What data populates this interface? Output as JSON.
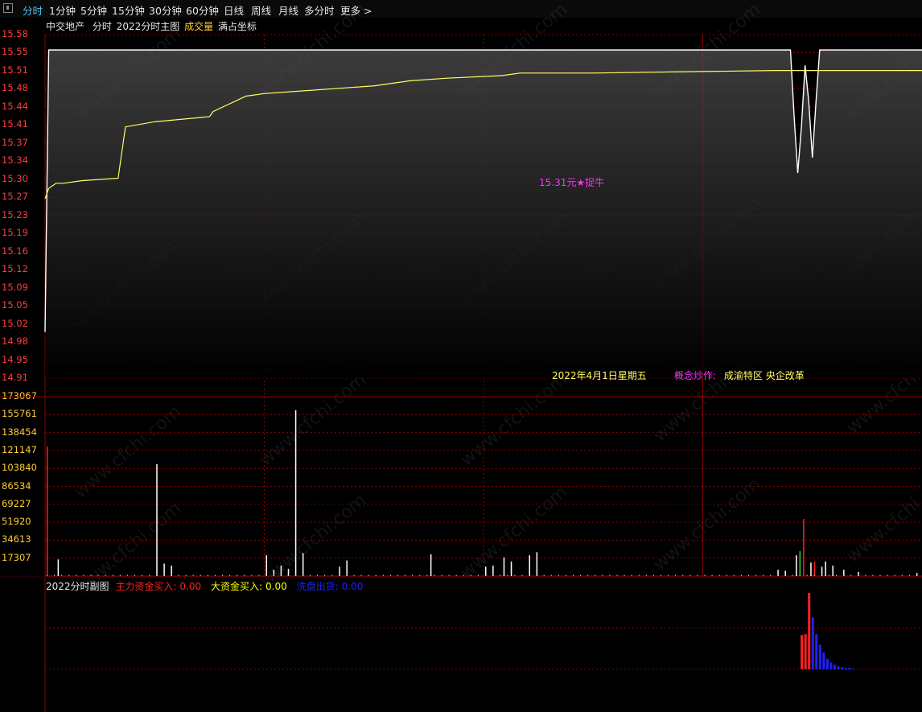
{
  "toolbar": {
    "tabs": [
      {
        "label": "分时",
        "active": true
      },
      {
        "label": "1分钟"
      },
      {
        "label": "5分钟"
      },
      {
        "label": "15分钟"
      },
      {
        "label": "30分钟"
      },
      {
        "label": "60分钟"
      },
      {
        "label": "日线"
      },
      {
        "label": "周线"
      },
      {
        "label": "月线"
      },
      {
        "label": "多分时"
      },
      {
        "label": "更多 >"
      }
    ]
  },
  "info": {
    "stock_name": "中交地产",
    "period": "分时",
    "indicator": "2022分时主图",
    "volume_label": "成交量",
    "scale_mode": "满占坐标"
  },
  "watermark": "www.cfchi.com",
  "annotations": {
    "signal": "15.31元★捉牛",
    "date": "2022年4月1日星期五",
    "concept_label": "概念炒作:",
    "concept_value": "成渝特区 央企改革"
  },
  "subchart": {
    "title": "2022分时副图",
    "main_label": "主力资金买入:",
    "main_value": "0.00",
    "big_label": "大资金买入:",
    "big_value": "0.00",
    "wash_label": "洗盘出货:",
    "wash_value": "0.00"
  },
  "colors": {
    "grid": "#8b0000",
    "price_axis": "#ff3c3c",
    "volume_axis": "#ffcc33",
    "avg_line": "#ffff66",
    "price_line": "#ffffff",
    "signal": "#ff33ff",
    "main_funds": "#ff2020",
    "big_funds": "#ffff00",
    "wash": "#2020ff"
  },
  "chart_data": [
    {
      "type": "line",
      "title": "2022分时主图",
      "y_ticks": [
        "15.58",
        "15.55",
        "15.51",
        "15.48",
        "15.44",
        "15.41",
        "15.37",
        "15.34",
        "15.30",
        "15.27",
        "15.23",
        "15.19",
        "15.16",
        "15.12",
        "15.09",
        "15.05",
        "15.02",
        "14.98",
        "14.95",
        "14.91"
      ],
      "ylim": [
        14.91,
        15.58
      ],
      "x": [
        0,
        1,
        2,
        3,
        5,
        10,
        20,
        22,
        30,
        45,
        46,
        55,
        60,
        70,
        80,
        90,
        100,
        110,
        125,
        130,
        135,
        150,
        200,
        226,
        229,
        232,
        235,
        240
      ],
      "series": [
        {
          "values": [
            15.0,
            15.55,
            15.55,
            15.55,
            15.55,
            15.55,
            15.55,
            15.55,
            15.55,
            15.55,
            15.55,
            15.55,
            15.55,
            15.55,
            15.55,
            15.55,
            15.55,
            15.55,
            15.55,
            15.55,
            15.55,
            15.55,
            15.55,
            15.55,
            15.55,
            15.55,
            15.55,
            15.55
          ]
        },
        {
          "values": [
            15.26,
            15.28,
            15.285,
            15.29,
            15.29,
            15.295,
            15.3,
            15.4,
            15.41,
            15.42,
            15.43,
            15.46,
            15.465,
            15.47,
            15.475,
            15.48,
            15.49,
            15.495,
            15.5,
            15.505,
            15.505,
            15.505,
            15.51,
            15.51,
            15.51,
            15.51,
            15.51,
            15.51
          ]
        }
      ],
      "dip": {
        "x": [
          204,
          205,
          206,
          207,
          208,
          209,
          210,
          211,
          212
        ],
        "values": [
          15.55,
          15.42,
          15.31,
          15.4,
          15.52,
          15.45,
          15.34,
          15.45,
          15.55
        ]
      },
      "grid": true
    },
    {
      "type": "bar",
      "title": "成交量",
      "y_ticks": [
        "173067",
        "155761",
        "138454",
        "121147",
        "103840",
        "86534",
        "69227",
        "51920",
        "34613",
        "17307"
      ],
      "ylim": [
        0,
        173067
      ],
      "bars": [
        {
          "x": 0,
          "value": 125000,
          "color": "red"
        },
        {
          "x": 3,
          "value": 16000,
          "color": "white"
        },
        {
          "x": 30,
          "value": 108000,
          "color": "white"
        },
        {
          "x": 32,
          "value": 12000,
          "color": "white"
        },
        {
          "x": 34,
          "value": 10000,
          "color": "white"
        },
        {
          "x": 60,
          "value": 20000,
          "color": "white"
        },
        {
          "x": 62,
          "value": 6000,
          "color": "white"
        },
        {
          "x": 64,
          "value": 10000,
          "color": "white"
        },
        {
          "x": 66,
          "value": 7000,
          "color": "white"
        },
        {
          "x": 68,
          "value": 160000,
          "color": "white"
        },
        {
          "x": 70,
          "value": 22000,
          "color": "white"
        },
        {
          "x": 80,
          "value": 9000,
          "color": "white"
        },
        {
          "x": 82,
          "value": 15000,
          "color": "white"
        },
        {
          "x": 105,
          "value": 21000,
          "color": "white"
        },
        {
          "x": 120,
          "value": 9000,
          "color": "white"
        },
        {
          "x": 122,
          "value": 10000,
          "color": "white"
        },
        {
          "x": 125,
          "value": 18000,
          "color": "white"
        },
        {
          "x": 127,
          "value": 14000,
          "color": "white"
        },
        {
          "x": 132,
          "value": 20000,
          "color": "white"
        },
        {
          "x": 134,
          "value": 23000,
          "color": "white"
        },
        {
          "x": 200,
          "value": 6000,
          "color": "white"
        },
        {
          "x": 202,
          "value": 5000,
          "color": "white"
        },
        {
          "x": 205,
          "value": 20000,
          "color": "white"
        },
        {
          "x": 206,
          "value": 24000,
          "color": "green"
        },
        {
          "x": 207,
          "value": 55000,
          "color": "red"
        },
        {
          "x": 209,
          "value": 13000,
          "color": "white"
        },
        {
          "x": 210,
          "value": 14000,
          "color": "red"
        },
        {
          "x": 212,
          "value": 9000,
          "color": "white"
        },
        {
          "x": 213,
          "value": 14000,
          "color": "white"
        },
        {
          "x": 215,
          "value": 10000,
          "color": "white"
        },
        {
          "x": 218,
          "value": 6000,
          "color": "white"
        },
        {
          "x": 222,
          "value": 4000,
          "color": "white"
        },
        {
          "x": 238,
          "value": 3000,
          "color": "white"
        }
      ],
      "grid": true
    },
    {
      "type": "bar",
      "title": "2022分时副图",
      "bars": [
        {
          "x": 207,
          "value": 0.45,
          "color": "red"
        },
        {
          "x": 208,
          "value": 0.46,
          "color": "red"
        },
        {
          "x": 209,
          "value": 1.0,
          "color": "red"
        },
        {
          "x": 210,
          "value": 0.68,
          "color": "blue"
        },
        {
          "x": 211,
          "value": 0.46,
          "color": "blue"
        },
        {
          "x": 212,
          "value": 0.32,
          "color": "blue"
        },
        {
          "x": 213,
          "value": 0.22,
          "color": "blue"
        },
        {
          "x": 214,
          "value": 0.14,
          "color": "blue"
        },
        {
          "x": 215,
          "value": 0.09,
          "color": "blue"
        },
        {
          "x": 216,
          "value": 0.06,
          "color": "blue"
        },
        {
          "x": 217,
          "value": 0.04,
          "color": "blue"
        },
        {
          "x": 218,
          "value": 0.03,
          "color": "blue"
        },
        {
          "x": 219,
          "value": 0.02,
          "color": "blue"
        },
        {
          "x": 220,
          "value": 0.02,
          "color": "blue"
        },
        {
          "x": 221,
          "value": 0.01,
          "color": "blue"
        }
      ]
    }
  ]
}
